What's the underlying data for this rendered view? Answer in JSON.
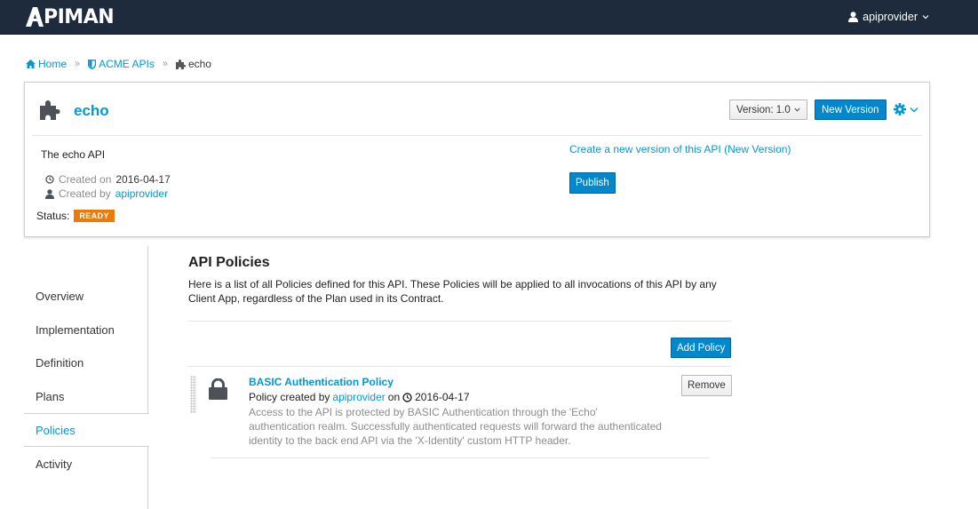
{
  "navbar": {
    "logo_text": "PIMAN",
    "user_name": "apiprovider"
  },
  "breadcrumb": {
    "home": "Home",
    "org": "ACME APIs",
    "api": "echo"
  },
  "api": {
    "name": "echo",
    "version_label": "Version: 1.0",
    "new_version_label": "New Version",
    "description": "The echo API",
    "created_on_label": "Created on",
    "created_on": "2016-04-17",
    "created_by_label": "Created by",
    "created_by": "apiprovider",
    "status_label": "Status:",
    "status": "READY",
    "create_version_link": "Create a new version of this API (New Version)",
    "publish_label": "Publish"
  },
  "sidenav": {
    "items": [
      {
        "label": "Overview"
      },
      {
        "label": "Implementation"
      },
      {
        "label": "Definition"
      },
      {
        "label": "Plans"
      },
      {
        "label": "Policies"
      },
      {
        "label": "Activity"
      }
    ],
    "active": "Policies"
  },
  "policies": {
    "title": "API Policies",
    "description": "Here is a list of all Policies defined for this API. These Policies will be applied to all invocations of this API by any Client App, regardless of the Plan used in its Contract.",
    "add_label": "Add Policy",
    "items": [
      {
        "name": "BASIC Authentication Policy",
        "created_prefix": "Policy created by",
        "created_by": "apiprovider",
        "on_label": "on",
        "date": "2016-04-17",
        "description": "Access to the API is protected by BASIC Authentication through the 'Echo' authentication realm. Successfully authenticated requests will forward the authenticated identity to the back end API via the 'X-Identity' custom HTTP header.",
        "remove_label": "Remove"
      }
    ]
  },
  "colors": {
    "navbar": "#1d2b3d",
    "link": "#0099d3",
    "primary_button": "#0088ce",
    "status_badge": "#ec7a08"
  }
}
